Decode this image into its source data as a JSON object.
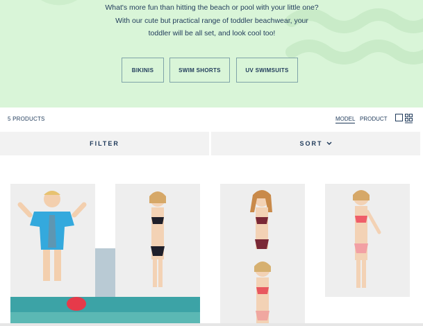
{
  "hero": {
    "description": "What's more fun than hitting the beach or pool with your little one? With our cute but practical range of toddler beachwear, your toddler will be all set, and look cool too!",
    "buttons": [
      "BIKINIS",
      "SWIM SHORTS",
      "UV SWIMSUITS"
    ]
  },
  "toolbar": {
    "product_count": "5 PRODUCTS",
    "view_model": "MODEL",
    "view_product": "PRODUCT"
  },
  "filter_bar": {
    "filter_label": "FILTER",
    "sort_label": "SORT"
  },
  "colors": {
    "hero_bg": "#d9f5d8",
    "text": "#1f3a5a",
    "button_border": "#7fa3a8",
    "bar_bg": "#f2f2f2"
  },
  "icons": [
    "single-column-view-icon",
    "grid-view-icon",
    "chevron-down-icon"
  ]
}
